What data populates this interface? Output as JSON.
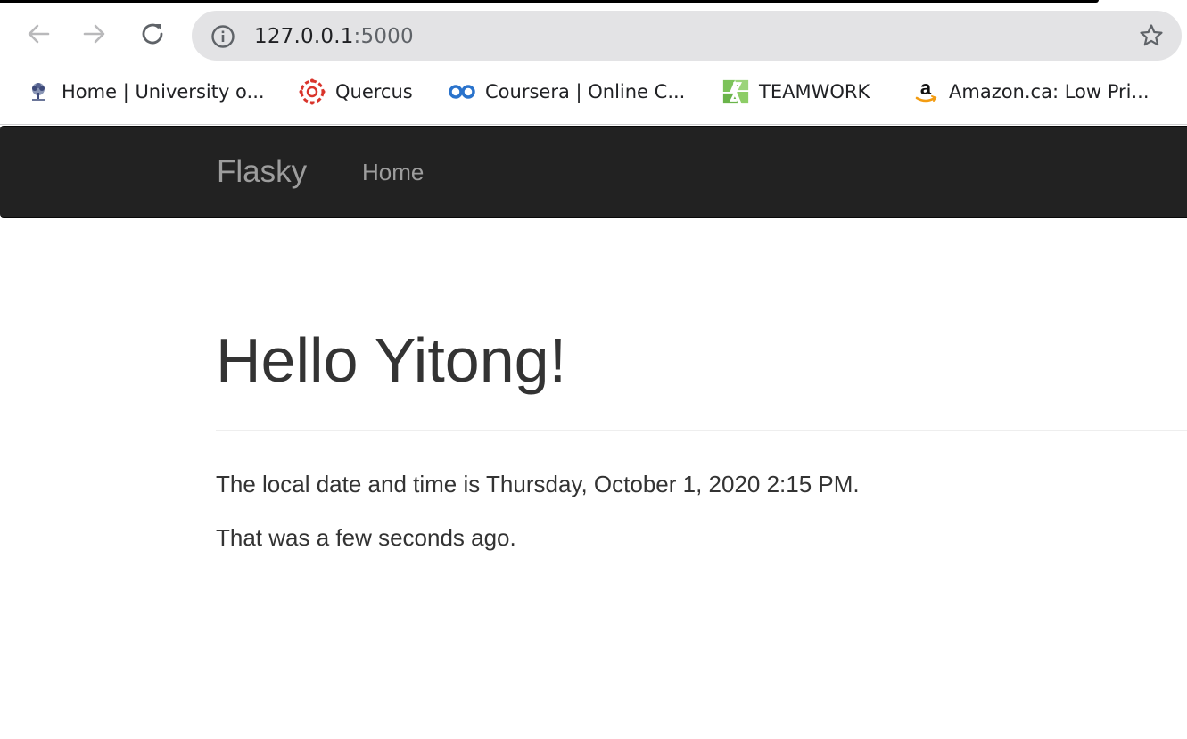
{
  "browser": {
    "url_host": "127.0.0.1",
    "url_port": ":5000",
    "icons": {
      "back": "arrow-left-icon",
      "forward": "arrow-right-icon",
      "reload": "reload-icon",
      "site_info": "info-icon",
      "bookmark": "star-icon"
    }
  },
  "bookmarks": [
    {
      "label": "Home | University o...",
      "icon": "university-crest-icon"
    },
    {
      "label": "Quercus",
      "icon": "quercus-logo-icon"
    },
    {
      "label": "Coursera | Online C...",
      "icon": "coursera-logo-icon"
    },
    {
      "label": "TEAMWORK",
      "icon": "teamwork-logo-icon"
    },
    {
      "label": "Amazon.ca: Low Pri...",
      "icon": "amazon-logo-icon"
    }
  ],
  "navbar": {
    "brand": "Flasky",
    "links": [
      "Home"
    ]
  },
  "main": {
    "greeting": "Hello Yitong!",
    "datetime_line": "The local date and time is Thursday, October 1, 2020 2:15 PM.",
    "relative_line": "That was a few seconds ago."
  },
  "colors": {
    "navbar_bg": "#222222",
    "nav_text": "#9d9d9d",
    "body_text": "#333333",
    "omnibox_bg": "#e3e3e5"
  }
}
